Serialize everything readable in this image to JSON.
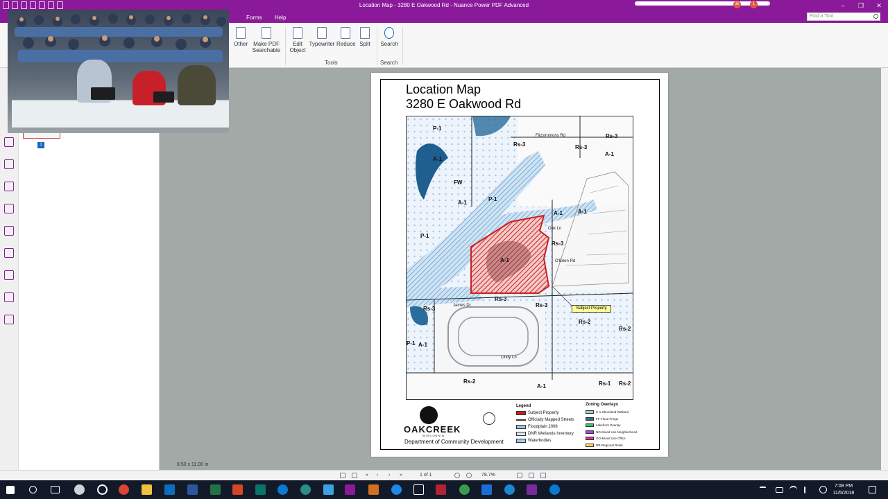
{
  "window": {
    "title": "Location Map - 3280 E Oakwood Rd - Nuance Power PDF Advanced",
    "badges": [
      "36",
      "1"
    ]
  },
  "menu": {
    "items": [
      "Forms",
      "Help"
    ],
    "find_placeholder": "Find a Tool"
  },
  "ribbon": {
    "buttons": [
      {
        "label": "Other",
        "name": "other-button"
      },
      {
        "label": "Make PDF Searchable",
        "name": "make-pdf-searchable-button"
      },
      {
        "label": "Edit Object",
        "name": "edit-object-button"
      },
      {
        "label": "Typewriter",
        "name": "typewriter-button"
      },
      {
        "label": "Reduce",
        "name": "reduce-button"
      },
      {
        "label": "Split",
        "name": "split-button"
      },
      {
        "label": "Search",
        "name": "search-button"
      }
    ],
    "groups": {
      "tools": "Tools",
      "search": "Search"
    }
  },
  "thumbnails": {
    "page_number": "1"
  },
  "document": {
    "title_line1": "Location Map",
    "title_line2": "3280 E Oakwood Rd",
    "subject_callout": "Subject Property",
    "map_labels": {
      "p1_top": "P-1",
      "rs3_a": "Rs-3",
      "rs3_b": "Rs-3",
      "rs3_c": "Rs-3",
      "a1_nw": "A-1",
      "a1_ne": "A-1",
      "fw": "FW",
      "p1_mid": "P-1",
      "a1_mid": "A-1",
      "p1_left": "P-1",
      "rs3_oak": "Rs-3",
      "a1_subject": "A-1",
      "rs3_james": "Rs-3",
      "rs3_s": "Rs-3",
      "rs3_w": "Rs-3",
      "rs2_e": "Rs-2",
      "rs2_far": "Rs-2",
      "p1_sw": "P-1",
      "a1_sw": "A-1",
      "rs2_s": "Rs-2",
      "a1_s": "A-1",
      "rs1_se": "Rs-1",
      "rs2_se": "Rs-2",
      "p1_ne2": "A-1",
      "a1_oak": "A-1"
    },
    "street_labels": {
      "fitzsimmons": "Fitzsimmons Rd",
      "oak": "Oak Ln",
      "obrien": "O'Brien Rd",
      "james": "James Dr",
      "lindy": "Lindy Ln"
    },
    "logo": {
      "name": "OAKCREEK",
      "state": "WISCONSIN",
      "department": "Department of Community Development"
    },
    "legend": {
      "title": "Legend",
      "items": [
        {
          "label": "Subject Property",
          "color": "#cc1f1f"
        },
        {
          "label": "Officially Mapped Streets",
          "color": "#222222"
        },
        {
          "label": "Floodplain 2008",
          "color": "#9fc3e0"
        },
        {
          "label": "DNR Wetlands Inventory",
          "color": "#d6e6f5"
        },
        {
          "label": "Waterbodies",
          "color": "#9ad0ea"
        }
      ]
    },
    "overlays": {
      "title": "Zoning Overlays",
      "items": [
        {
          "label": "C-1-Shoreland Wetland",
          "color": "#7fe0b0"
        },
        {
          "label": "FF-Flood Fringe",
          "color": "#2f6a92"
        },
        {
          "label": "Lakefront Overlay",
          "color": "#39c36b"
        },
        {
          "label": "NO-Mixed Use Neighborhood",
          "color": "#a64ac9"
        },
        {
          "label": "OO-Mixed Use Office",
          "color": "#d83a7a"
        },
        {
          "label": "RR-Regional Retail",
          "color": "#f2e05a"
        }
      ]
    },
    "page_size": "8.50 x 11.00 in"
  },
  "statusbar": {
    "page_indicator": "1 of 1",
    "zoom": "78.7%"
  },
  "taskbar": {
    "time": "7:08 PM",
    "date": "11/5/2018"
  }
}
